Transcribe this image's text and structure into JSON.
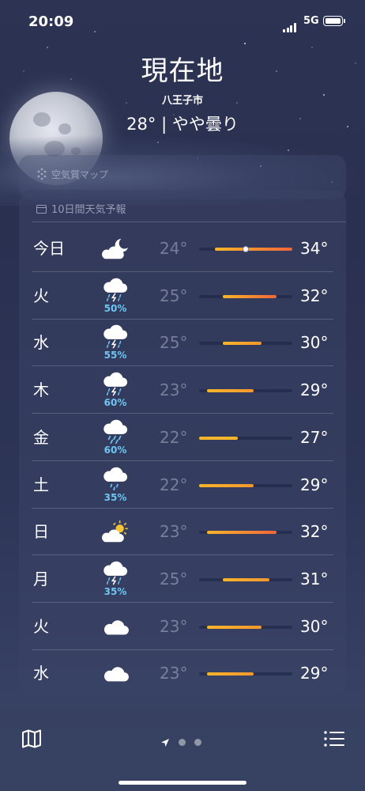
{
  "status_bar": {
    "time": "20:09",
    "network": "5G"
  },
  "header": {
    "location": "現在地",
    "city": "八王子市",
    "condition": "28° | やや曇り"
  },
  "air_quality": {
    "title": "空気質マップ"
  },
  "forecast": {
    "title": "10日間天気予報",
    "days": [
      {
        "day": "今日",
        "icon": "partly-cloudy-night-icon",
        "pop": "",
        "low": "24°",
        "high": "34°",
        "bar_from": 24,
        "bar_to": 34,
        "current": 28
      },
      {
        "day": "火",
        "icon": "thunderstorm-icon",
        "pop": "50%",
        "low": "25°",
        "high": "32°",
        "bar_from": 25,
        "bar_to": 32
      },
      {
        "day": "水",
        "icon": "thunderstorm-icon",
        "pop": "55%",
        "low": "25°",
        "high": "30°",
        "bar_from": 25,
        "bar_to": 30
      },
      {
        "day": "木",
        "icon": "thunderstorm-icon",
        "pop": "60%",
        "low": "23°",
        "high": "29°",
        "bar_from": 23,
        "bar_to": 29
      },
      {
        "day": "金",
        "icon": "rain-icon",
        "pop": "60%",
        "low": "22°",
        "high": "27°",
        "bar_from": 22,
        "bar_to": 27
      },
      {
        "day": "土",
        "icon": "drizzle-icon",
        "pop": "35%",
        "low": "22°",
        "high": "29°",
        "bar_from": 22,
        "bar_to": 29
      },
      {
        "day": "日",
        "icon": "partly-sunny-icon",
        "pop": "",
        "low": "23°",
        "high": "32°",
        "bar_from": 23,
        "bar_to": 32
      },
      {
        "day": "月",
        "icon": "thunderstorm-icon",
        "pop": "35%",
        "low": "25°",
        "high": "31°",
        "bar_from": 25,
        "bar_to": 31
      },
      {
        "day": "火",
        "icon": "cloud-icon",
        "pop": "",
        "low": "23°",
        "high": "30°",
        "bar_from": 23,
        "bar_to": 30
      },
      {
        "day": "水",
        "icon": "cloud-icon",
        "pop": "",
        "low": "23°",
        "high": "29°",
        "bar_from": 23,
        "bar_to": 29
      }
    ],
    "range_min": 22,
    "range_max": 34
  },
  "tab_bar": {
    "left_icon": "map-icon",
    "right_icon": "list-icon",
    "page_dots": 2
  },
  "colors": {
    "pop": "#6ec6f2",
    "bar_warm": "#f7b52a",
    "bar_hot": "#f0663a"
  }
}
